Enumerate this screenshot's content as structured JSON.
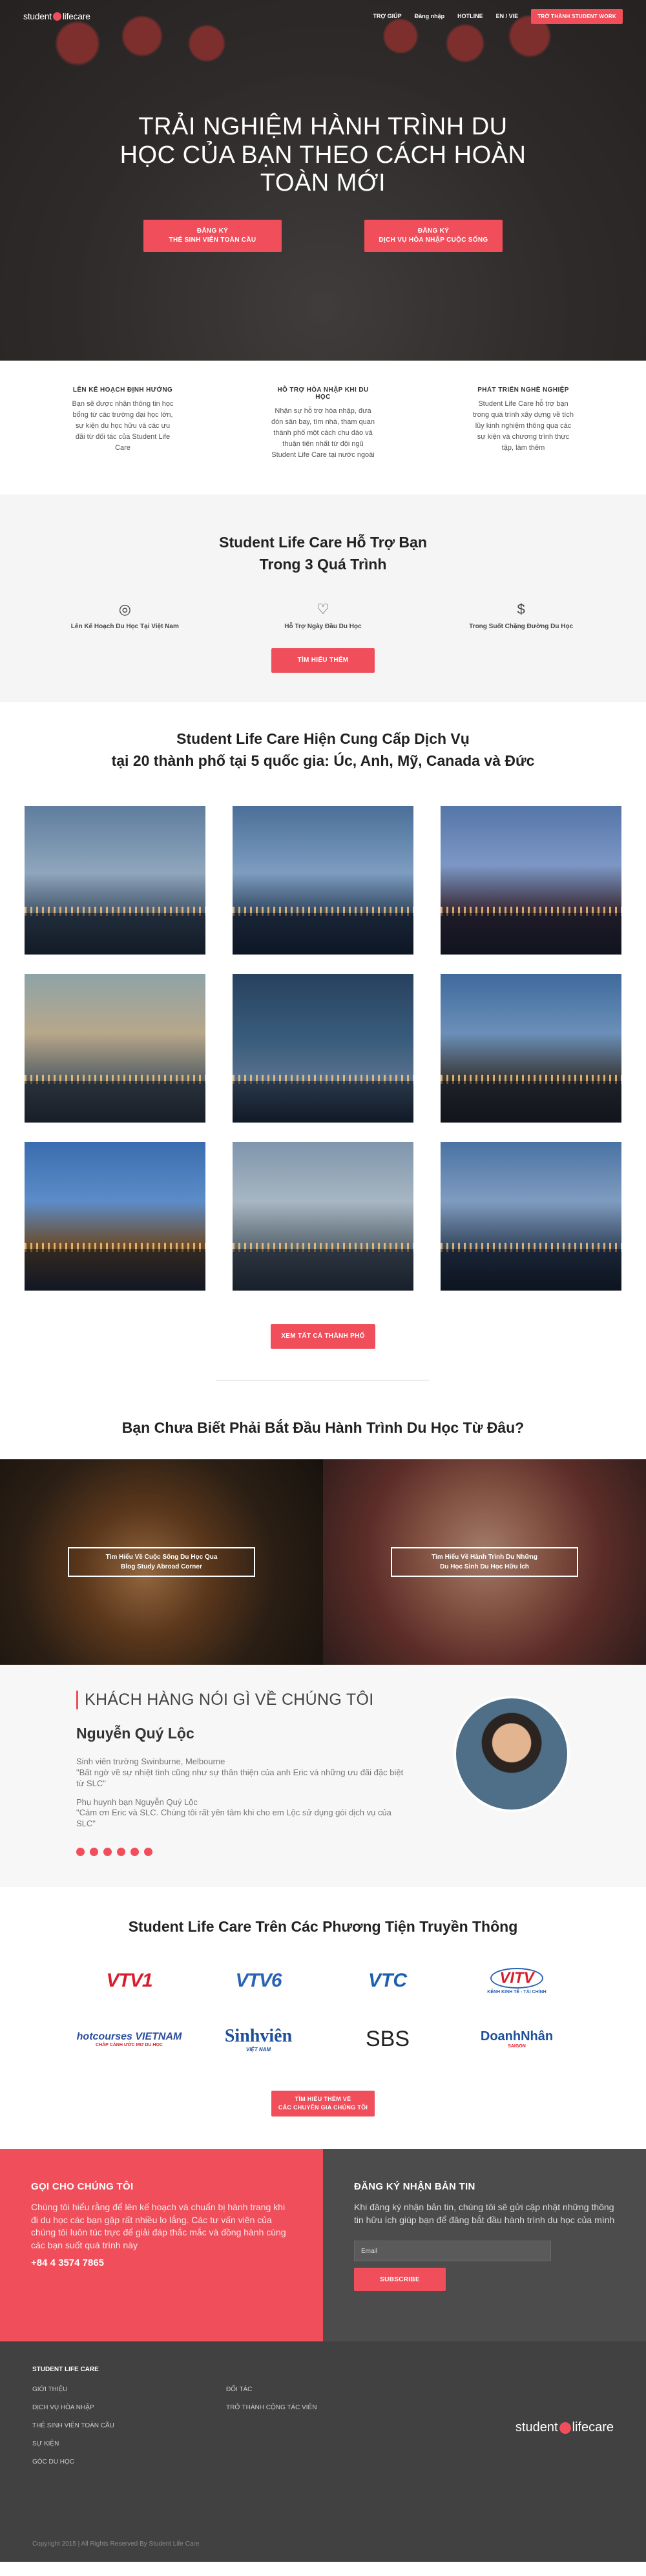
{
  "nav": {
    "logo_left": "student",
    "logo_right": "lifecare",
    "links": [
      "TRỢ GIÚP",
      "Đăng nhập",
      "HOTLINE",
      "EN / VIE"
    ],
    "cta": "TRỞ THÀNH STUDENT WORK"
  },
  "hero": {
    "title": "TRẢI NGHIỆM HÀNH TRÌNH DU HỌC CỦA BẠN THEO CÁCH HOÀN TOÀN MỚI",
    "btn1_line1": "ĐĂNG KÝ",
    "btn1_line2": "THẺ SINH VIÊN TOÀN CẦU",
    "btn2_line1": "ĐĂNG KÝ",
    "btn2_line2": "DỊCH VỤ HÒA NHẬP CUỘC SỐNG"
  },
  "features": [
    {
      "title": "LÊN KẾ HOẠCH ĐỊNH HƯỚNG",
      "text": "Bạn sẽ được nhận thông tin học bổng từ các trường đại học lớn, sự kiện du học hữu và các ưu đãi từ đối tác của Student Life Care"
    },
    {
      "title": "HỖ TRỢ HÒA NHẬP KHI DU HỌC",
      "text": "Nhận sự hỗ trợ hòa nhập, đưa đón sân bay, tìm nhà, tham quan thành phố một cách chu đáo và thuận tiện nhất từ đội ngũ Student Life Care tại nước ngoài"
    },
    {
      "title": "PHÁT TRIỂN NGHỀ NGHIỆP",
      "text": "Student Life Care hỗ trợ bạn trong quá trình xây dựng về tích lũy kinh nghiệm thông qua các sự kiện và chương trình thực tập, làm thêm"
    }
  ],
  "support": {
    "title_line1": "Student Life Care Hỗ Trợ Bạn",
    "title_line2": "Trong 3 Quá Trình",
    "steps": [
      "Lên Kế Hoạch Du Học Tại Việt Nam",
      "Hỗ Trợ Ngày Đầu Du Học",
      "Trong Suốt Chặng Đường Du Học"
    ],
    "button": "TÌM HIỂU THÊM"
  },
  "cities": {
    "title_line1": "Student Life Care Hiện Cung Cấp Dịch Vụ",
    "title_line2": "tại 20 thành phố tại 5 quốc gia: Úc, Anh, Mỹ, Canada và Đức",
    "button": "XEM TẤT CẢ THÀNH PHỐ"
  },
  "where": {
    "title": "Bạn Chưa Biết Phải Bắt Đầu Hành Trình Du Học Từ Đâu?",
    "left_line1": "Tìm Hiểu Về Cuộc Sống Du Học Qua",
    "left_line2": "Blog Study Abroad Corner",
    "right_line1": "Tìm Hiểu Về Hành Trình Du Những",
    "right_line2": "Du Học Sinh Du Học Hữu Ích"
  },
  "testimonial": {
    "heading": "KHÁCH HÀNG NÓI GÌ VỀ CHÚNG TÔI",
    "name": "Nguyễn Quý Lộc",
    "p1_line1": "Sinh viên trường Swinburne, Melbourne",
    "p1_line2": "\"Bất ngờ về sự nhiệt tình cũng như sự thân thiện của anh Eric và những ưu đãi đặc biệt từ SLC\"",
    "p2_line1": "Phụ huynh bạn Nguyễn Quý Lộc",
    "p2_line2": "\"Cám ơn Eric và SLC. Chúng tôi rất yên tâm khi cho em Lộc sử dụng gói dịch vụ của SLC\""
  },
  "media": {
    "title": "Student Life Care Trên Các Phương Tiện Truyền Thông",
    "logos": [
      "VTV1",
      "VTV6",
      "VTC",
      "VITV",
      "hotcourses VIETNAM",
      "Sinhviên",
      "SBS",
      "DoanhNhân"
    ],
    "logo_sub_vitv": "KÊNH KINH TẾ - TÀI CHÍNH",
    "logo_sub_hotcourses": "CHẮP CÁNH ƯỚC MƠ DU HỌC",
    "logo_sub_sinhvien": "VIỆT NAM",
    "logo_sub_doanhnhan": "SAIGON",
    "button_line1": "TÌM HIỂU THÊM VỀ",
    "button_line2": "CÁC CHUYÊN GIA CHÚNG TÔI"
  },
  "contact": {
    "left_title": "GỌI CHO CHÚNG TÔI",
    "left_text": "Chúng tôi hiểu rằng để lên kế hoạch và chuẩn bị hành trang khi đi du học các bạn gặp rất nhiều lo lắng. Các tư vấn viên của chúng tôi luôn túc trực để giải đáp thắc mắc và đồng hành cùng các bạn suốt quá trình này",
    "phone": "+84 4 3574 7865",
    "right_title": "ĐĂNG KÝ NHẬN BẢN TIN",
    "right_text": "Khi đăng ký nhận bản tin, chúng tôi sẽ gửi cập nhật những thông tin hữu ích giúp bạn để đăng bắt đầu hành trình du học của mình",
    "email_placeholder": "Email",
    "subscribe": "SUBSCRIBE"
  },
  "footer": {
    "heading": "STUDENT LIFE CARE",
    "col1": [
      "GIỚI THIỆU",
      "DỊCH VỤ HÒA NHẬP",
      "THẺ SINH VIÊN TOÀN CẦU",
      "SỰ KIỆN",
      "GÓC DU HỌC"
    ],
    "col2": [
      "ĐỐI TÁC",
      "TRỞ THÀNH CỘNG TÁC VIÊN"
    ],
    "logo_left": "student",
    "logo_right": "lifecare",
    "copyright": "Copyright 2015 | All Rights Reserved By Student Life Care"
  },
  "colors": {
    "accent": "#f04e5a",
    "dark": "#4c4c4c",
    "footer": "#414141"
  }
}
